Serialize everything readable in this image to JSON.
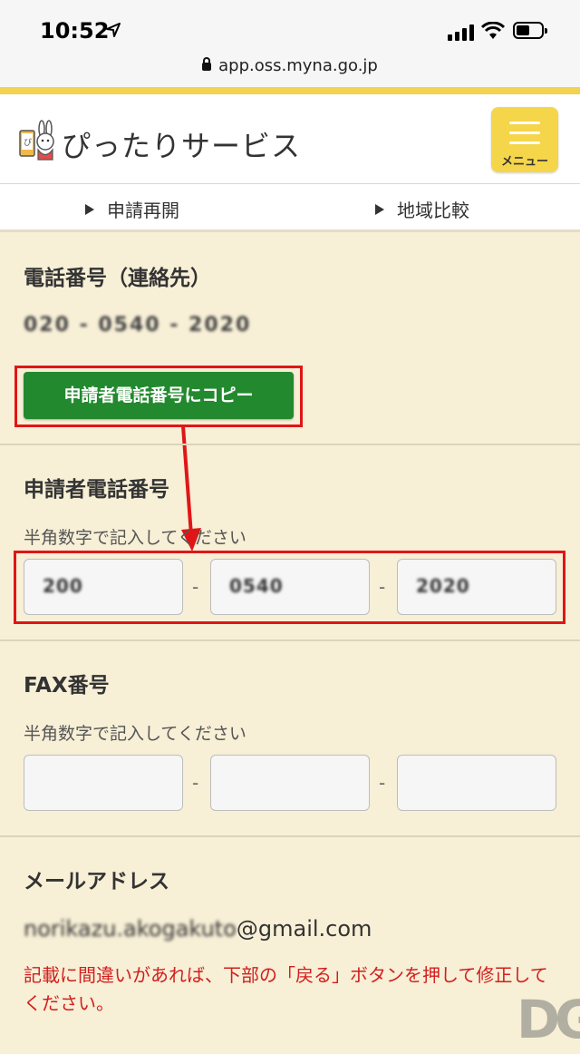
{
  "status_bar": {
    "time": "10:52",
    "url": "app.oss.myna.go.jp"
  },
  "header": {
    "logo_text": "ぴったりサービス",
    "menu_label": "メニュー"
  },
  "nav": {
    "items": [
      "申請再開",
      "地域比較"
    ]
  },
  "contact_phone": {
    "title": "電話番号（連絡先）",
    "value": "020 - 0540 - 2020"
  },
  "copy_button": {
    "label": "申請者電話番号にコピー"
  },
  "applicant_phone": {
    "title": "申請者電話番号",
    "hint": "半角数字で記入してください",
    "values": [
      "200",
      "0540",
      "2020"
    ],
    "separator": "-"
  },
  "fax": {
    "title": "FAX番号",
    "hint": "半角数字で記入してください",
    "values": [
      "",
      "",
      ""
    ],
    "separator": "-"
  },
  "email": {
    "title": "メールアドレス",
    "local_part": "norikazu.akogakuto",
    "domain": "@gmail.com"
  },
  "notice": "記載に間違いがあれば、下部の「戻る」ボタンを押して修正してください。",
  "watermark": "DG",
  "colors": {
    "background": "#f7efd6",
    "accent_yellow": "#f5d54a",
    "copy_button_green": "#23892e",
    "highlight_red": "#e01616",
    "notice_red": "#d21f1f"
  }
}
